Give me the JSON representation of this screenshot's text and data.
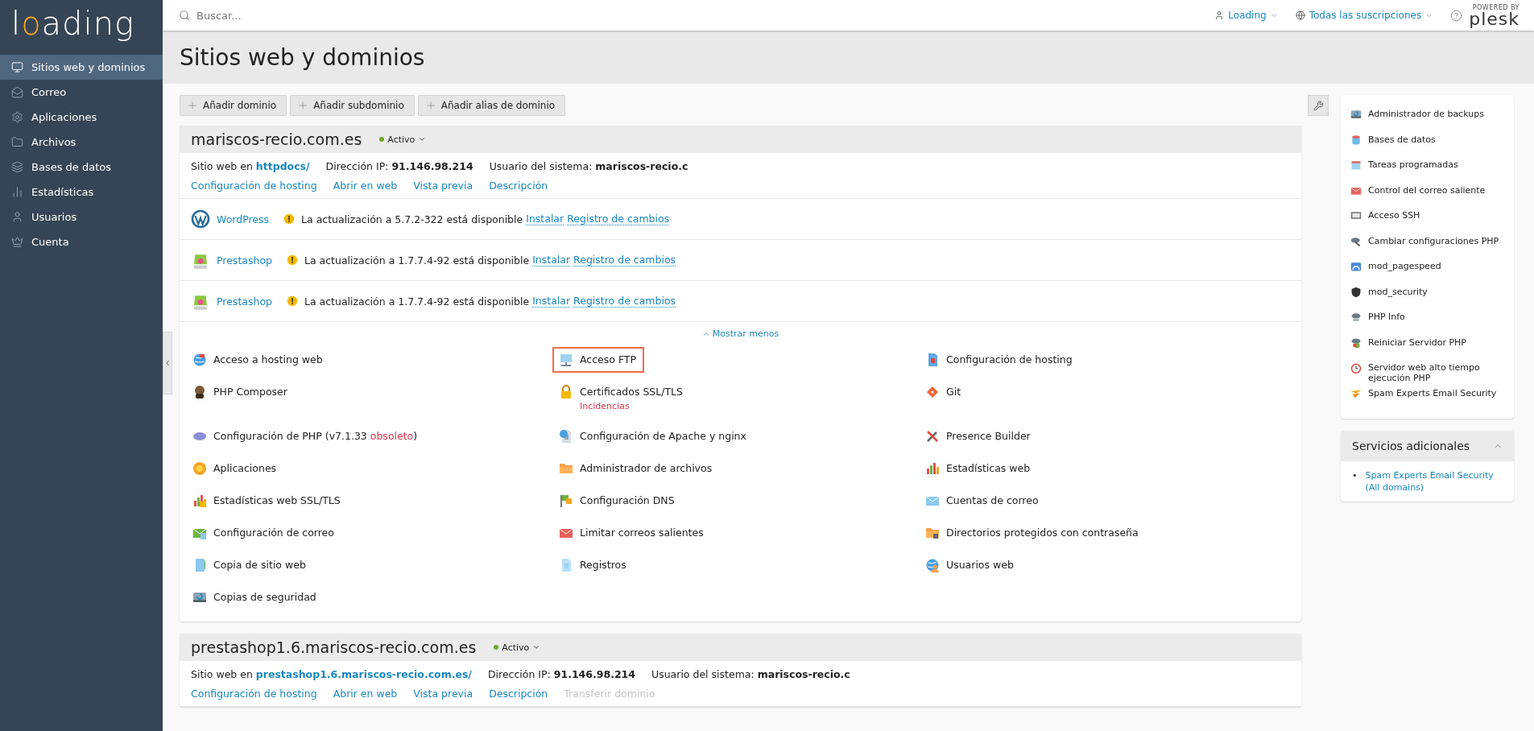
{
  "sidebar": {
    "logo": [
      {
        "text": "l",
        "accent": false
      },
      {
        "text": "o",
        "accent": true
      },
      {
        "text": "ading",
        "accent": false
      }
    ],
    "items": [
      {
        "label": "Sitios web y dominios",
        "selected": true
      },
      {
        "label": "Correo",
        "selected": false
      },
      {
        "label": "Aplicaciones",
        "selected": false
      },
      {
        "label": "Archivos",
        "selected": false
      },
      {
        "label": "Bases de datos",
        "selected": false
      },
      {
        "label": "Estadísticas",
        "selected": false
      },
      {
        "label": "Usuarios",
        "selected": false
      },
      {
        "label": "Cuenta",
        "selected": false
      }
    ]
  },
  "topbar": {
    "search": {
      "placeholder": "Buscar..."
    },
    "user": "Loading",
    "subscriptions": "Todas las suscripciones",
    "brand": {
      "caption": "POWERED BY",
      "name": "plesk"
    }
  },
  "page_title": "Sitios web y dominios",
  "toolbar": [
    "Añadir dominio",
    "Añadir subdominio",
    "Añadir alias de dominio"
  ],
  "domains": [
    {
      "name": "mariscos-recio.com.es",
      "status": "Activo",
      "site_prefix": "Sitio web en",
      "site_path": "httpdocs/",
      "ip_label": "Dirección IP:",
      "ip": "91.146.98.214",
      "user_label": "Usuario del sistema:",
      "user": "mariscos-recio.c",
      "links": [
        {
          "label": "Configuración de hosting",
          "disabled": false
        },
        {
          "label": "Abrir en web",
          "disabled": false
        },
        {
          "label": "Vista previa",
          "disabled": false
        },
        {
          "label": "Descripción",
          "disabled": false
        }
      ],
      "apps": [
        {
          "kind": "wordpress",
          "name": "WordPress",
          "message": "La actualización a 5.7.2-322 está disponible",
          "actions": [
            "Instalar",
            "Registro de cambios"
          ]
        },
        {
          "kind": "prestashop",
          "name": "Prestashop",
          "message": "La actualización a 1.7.7.4-92 está disponible",
          "actions": [
            "Instalar",
            "Registro de cambios"
          ]
        },
        {
          "kind": "prestashop",
          "name": "Prestashop",
          "message": "La actualización a 1.7.7.4-92 está disponible",
          "actions": [
            "Instalar",
            "Registro de cambios"
          ]
        }
      ],
      "toggle": "Mostrar menos",
      "tools": [
        {
          "label": "Acceso a hosting web",
          "highlighted": false
        },
        {
          "label": "Acceso FTP",
          "highlighted": true
        },
        {
          "label": "Configuración de hosting",
          "highlighted": false
        },
        {
          "label": "PHP Composer",
          "highlighted": false
        },
        {
          "label": "Certificados SSL/TLS",
          "highlighted": false,
          "note": "Incidencias"
        },
        {
          "label": "Git",
          "highlighted": false
        },
        {
          "label": "Configuración de PHP (v7.1.33",
          "highlighted": false,
          "warning": "obsoleto",
          "suffix": ")"
        },
        {
          "label": "Configuración de Apache y nginx",
          "highlighted": false
        },
        {
          "label": "Presence Builder",
          "highlighted": false
        },
        {
          "label": "Aplicaciones",
          "highlighted": false
        },
        {
          "label": "Administrador de archivos",
          "highlighted": false
        },
        {
          "label": "Estadísticas web",
          "highlighted": false
        },
        {
          "label": "Estadísticas web SSL/TLS",
          "highlighted": false
        },
        {
          "label": "Configuración DNS",
          "highlighted": false
        },
        {
          "label": "Cuentas de correo",
          "highlighted": false
        },
        {
          "label": "Configuración de correo",
          "highlighted": false
        },
        {
          "label": "Limitar correos salientes",
          "highlighted": false
        },
        {
          "label": "Directorios protegidos con contraseña",
          "highlighted": false
        },
        {
          "label": "Copia de sitio web",
          "highlighted": false
        },
        {
          "label": "Registros",
          "highlighted": false
        },
        {
          "label": "Usuarios web",
          "highlighted": false
        },
        {
          "label": "Copias de seguridad",
          "highlighted": false
        }
      ]
    },
    {
      "name": "prestashop1.6.mariscos-recio.com.es",
      "status": "Activo",
      "site_prefix": "Sitio web en",
      "site_path": "prestashop1.6.mariscos-recio.com.es/",
      "ip_label": "Dirección IP:",
      "ip": "91.146.98.214",
      "user_label": "Usuario del sistema:",
      "user": "mariscos-recio.c",
      "links": [
        {
          "label": "Configuración de hosting",
          "disabled": false
        },
        {
          "label": "Abrir en web",
          "disabled": false
        },
        {
          "label": "Vista previa",
          "disabled": false
        },
        {
          "label": "Descripción",
          "disabled": false
        },
        {
          "label": "Transferir dominio",
          "disabled": true
        }
      ]
    }
  ],
  "right_panel": {
    "tools": [
      "Administrador de backups",
      "Bases de datos",
      "Tareas programadas",
      "Control del correo saliente",
      "Acceso SSH",
      "Cambiar configuraciones PHP",
      "mod_pagespeed",
      "mod_security",
      "PHP Info",
      "Reiniciar Servidor PHP",
      "Servidor web alto tiempo ejecución PHP",
      "Spam Experts Email Security"
    ],
    "services": {
      "title": "Servicios adicionales",
      "expanded": true,
      "bullet": "•",
      "items": [
        "Spam Experts Email Security (All domains)"
      ]
    }
  }
}
